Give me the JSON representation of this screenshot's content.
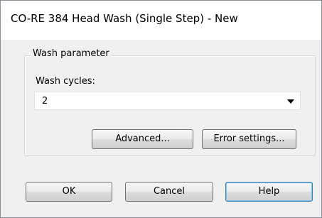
{
  "window": {
    "title": "CO-RE 384 Head Wash (Single Step) - New"
  },
  "wash_parameter": {
    "group_label": "Wash parameter",
    "wash_cycles_label": "Wash cycles:",
    "wash_cycles_value": "2"
  },
  "buttons": {
    "advanced": "Advanced...",
    "error_settings": "Error settings...",
    "ok": "OK",
    "cancel": "Cancel",
    "help": "Help"
  },
  "icons": {
    "dropdown": "chevron-down-icon"
  }
}
